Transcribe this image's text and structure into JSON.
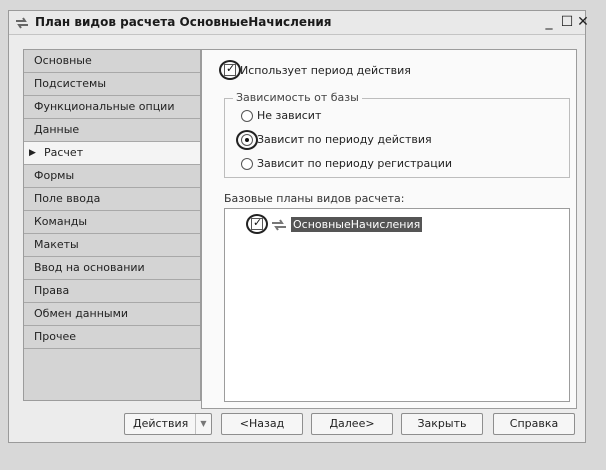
{
  "window": {
    "title": "План видов расчета ОсновныеНачисления",
    "min_glyph": "_",
    "max_glyph": "☐",
    "close_glyph": "✕"
  },
  "nav": {
    "active_index": 4,
    "items": [
      {
        "label": "Основные"
      },
      {
        "label": "Подсистемы"
      },
      {
        "label": "Функциональные опции"
      },
      {
        "label": "Данные"
      },
      {
        "label": "Расчет"
      },
      {
        "label": "Формы"
      },
      {
        "label": "Поле ввода"
      },
      {
        "label": "Команды"
      },
      {
        "label": "Макеты"
      },
      {
        "label": "Ввод на основании"
      },
      {
        "label": "Права"
      },
      {
        "label": "Обмен данными"
      },
      {
        "label": "Прочее"
      }
    ]
  },
  "calc": {
    "uses_period_label": "Использует период действия",
    "uses_period_checked": true,
    "dependency_group_title": "Зависимость от базы",
    "options": [
      {
        "label": "Не зависит",
        "selected": false
      },
      {
        "label": "Зависит по периоду действия",
        "selected": true
      },
      {
        "label": "Зависит по периоду регистрации",
        "selected": false
      }
    ],
    "base_plans_label": "Базовые планы видов расчета:",
    "base_plans": [
      {
        "label": "ОсновныеНачисления",
        "checked": true
      }
    ]
  },
  "buttons": {
    "actions": "Действия",
    "back": "<Назад",
    "next": "Далее>",
    "close": "Закрыть",
    "help": "Справка"
  },
  "icons": {
    "title": "arrows-swap-icon",
    "nav_active": "triangle-right-icon",
    "list_item": "arrows-swap-icon"
  }
}
